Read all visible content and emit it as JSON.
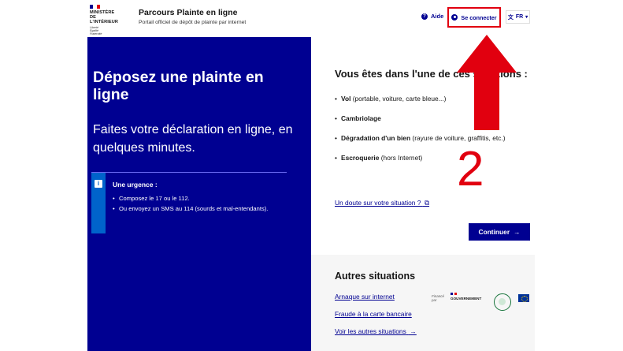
{
  "header": {
    "logo_lines": [
      "MINISTÈRE",
      "DE L'INTÉRIEUR"
    ],
    "logo_motto": [
      "Liberté",
      "Égalité",
      "Fraternité"
    ],
    "site_title": "Parcours Plainte en ligne",
    "site_tagline": "Portail officiel de dépôt de plainte par internet",
    "help_label": "Aide",
    "login_label": "Se connecter",
    "lang_label": "FR",
    "icons": {
      "help": "question-circle-icon",
      "user": "user-circle-icon",
      "translate": "translate-icon",
      "chevron": "chevron-down-icon"
    }
  },
  "hero": {
    "title": "Déposez une plainte en ligne",
    "subtitle": "Faites votre déclaration en ligne, en quelques minutes.",
    "urgent_title": "Une urgence :",
    "urgent_items": [
      "Composez le 17 ou le 112.",
      "Ou envoyez un SMS au 114 (sourds et mal-entendants)."
    ],
    "colors": {
      "background": "#000091",
      "info_bar": "#0063cb"
    }
  },
  "main": {
    "title": "Vous êtes dans l'une de ces situations :",
    "cases": [
      {
        "bold": "Vol",
        "rest": " (portable, voiture, carte bleue...)"
      },
      {
        "bold": "Cambriolage",
        "rest": ""
      },
      {
        "bold": "Dégradation d'un bien",
        "rest": " (rayure de voiture, graffitis, etc.)"
      },
      {
        "bold": "Escroquerie",
        "rest": " (hors Internet)"
      }
    ],
    "doubt_link": "Un doute sur votre situation ?",
    "continue_label": "Continuer"
  },
  "others": {
    "title": "Autres situations",
    "links": [
      "Arnaque sur internet",
      "Fraude à la carte bancaire",
      "Voir les autres situations"
    ],
    "funded_by": [
      "Financé",
      "par"
    ],
    "funder": "GOUVERNEMENT"
  },
  "annotation": {
    "number": "2",
    "color": "#e1000f"
  }
}
